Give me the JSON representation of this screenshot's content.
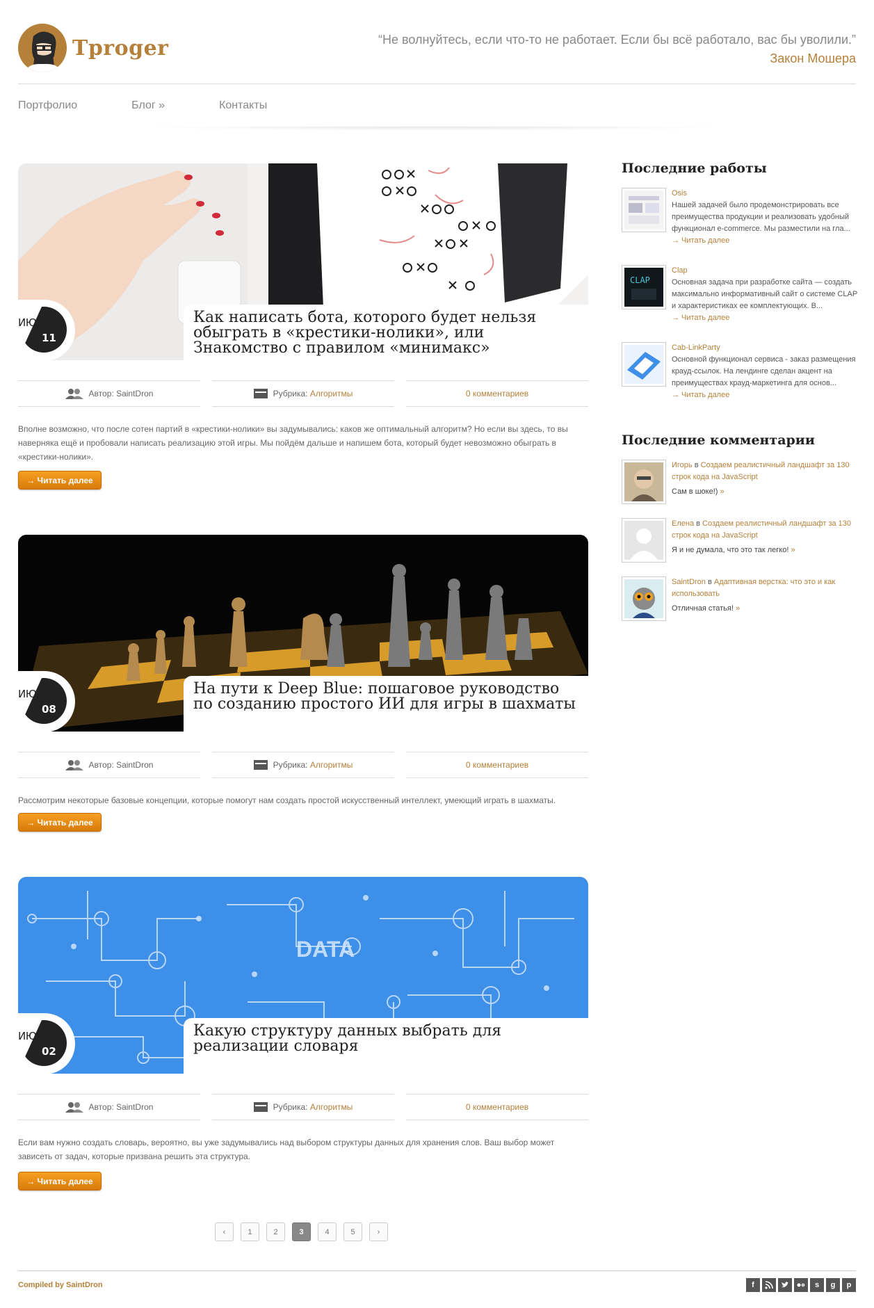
{
  "header": {
    "logo_text": "Tproger",
    "quote": "“Не волнуйтесь, если что-то не работает. Если бы всё работало, вас бы уволили.”",
    "quote_author": "Закон Мошера"
  },
  "nav": {
    "items": [
      "Портфолио",
      "Блог »",
      "Контакты"
    ]
  },
  "meta_labels": {
    "author_prefix": "Автор:",
    "rubric_prefix": "Рубрика:"
  },
  "posts": [
    {
      "month": "ИЮН",
      "day": "11",
      "title": "Как написать бота, которого будет нельзя обыграть в «крестики-нолики», или Знакомство с правилом «минимакс»",
      "author": "SaintDron",
      "category": "Алгоритмы",
      "comments": "0 комментариев",
      "excerpt": "Вполне возможно, что после сотен партий в «крестики-нолики» вы задумывались: каков же оптимальный алгоритм? Но если вы здесь, то вы наверняка ещё и пробовали написать реализацию этой игры. Мы пойдём дальше и напишем бота, который будет невозможно обыграть в «крестики-нолики».",
      "read_more": "→ Читать далее"
    },
    {
      "month": "ИЮН",
      "day": "08",
      "title": "На пути к Deep Blue: пошаговое руководство по созданию простого ИИ для игры в шахматы",
      "author": "SaintDron",
      "category": "Алгоритмы",
      "comments": "0 комментариев",
      "excerpt": "Рассмотрим некоторые базовые концепции, которые помогут нам создать простой искусственный интеллект, умеющий играть в шахматы.",
      "read_more": "→ Читать далее"
    },
    {
      "month": "ИЮН",
      "day": "02",
      "title": "Какую структуру данных выбрать для реализации словаря",
      "author": "SaintDron",
      "category": "Алгоритмы",
      "comments": "0 комментариев",
      "excerpt": "Если вам нужно создать словарь, вероятно, вы уже задумывались над выбором структуры данных для хранения слов. Ваш выбор может зависеть от задач, которые призвана решить эта структура.",
      "read_more": "→ Читать далее",
      "image_text": "DATA"
    }
  ],
  "sidebar": {
    "works_heading": "Последние работы",
    "works": [
      {
        "title": "Osis",
        "text": "Нашей задачей было продемонстрировать все преимущества продукции и реализовать удобный функционал e-commerce. Мы разместили на гла...",
        "more": "→ Читать далее"
      },
      {
        "title": "Clap",
        "text": "Основная задача при разработке сайта — создать максимально информативный сайт о системе CLAP и характеристиках ее комплектующих. В...",
        "more": "→ Читать далее",
        "thumb_text": "CLAP"
      },
      {
        "title": "Cab-LinkParty",
        "text": "Основной функционал сервиса - заказ размещения крауд-ссылок. На лендинге сделан акцент на преимуществах крауд-маркетинга для основ...",
        "more": "→ Читать далее"
      }
    ],
    "comments_heading": "Последние комментарии",
    "comments": [
      {
        "author": "Игорь",
        "in": "в",
        "post": "Создаем реалистичный ландшафт за 130 строк кода на JavaScript",
        "text": "Сам в шоке!)",
        "more": "»"
      },
      {
        "author": "Елена",
        "in": "в",
        "post": "Создаем реалистичный ландшафт за 130 строк кода на JavaScript",
        "text": "Я и не думала, что это так легко!",
        "more": "»"
      },
      {
        "author": "SaintDron",
        "in": "в",
        "post": "Адаптивная верстка: что это и как использовать",
        "text": "Отличная статья!",
        "more": "»"
      }
    ]
  },
  "pagination": {
    "prev": "‹",
    "pages": [
      "1",
      "2",
      "3",
      "4",
      "5"
    ],
    "current": "3",
    "next": "›"
  },
  "footer": {
    "credit": "Compiled by SaintDron",
    "socials": [
      "f",
      "rss",
      "t",
      "••",
      "s",
      "g",
      "p"
    ]
  },
  "colors": {
    "accent": "#b5803a",
    "button": "#e8890f",
    "data_blue": "#3d8fe8"
  }
}
